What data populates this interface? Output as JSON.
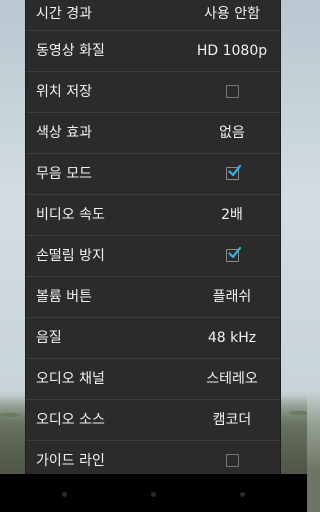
{
  "settings": [
    {
      "label": "시간 경과",
      "value": "사용 안함",
      "type": "text"
    },
    {
      "label": "동영상 화질",
      "value": "HD 1080p",
      "type": "text"
    },
    {
      "label": "위치 저장",
      "checked": false,
      "type": "checkbox"
    },
    {
      "label": "색상 효과",
      "value": "없음",
      "type": "text"
    },
    {
      "label": "무음 모드",
      "checked": true,
      "type": "checkbox"
    },
    {
      "label": "비디오 속도",
      "value": "2배",
      "type": "text"
    },
    {
      "label": "손떨림 방지",
      "checked": true,
      "type": "checkbox"
    },
    {
      "label": "볼륨 버튼",
      "value": "플래쉬",
      "type": "text"
    },
    {
      "label": "음질",
      "value": "48 kHz",
      "type": "text"
    },
    {
      "label": "오디오 채널",
      "value": "스테레오",
      "type": "text"
    },
    {
      "label": "오디오 소스",
      "value": "캠코더",
      "type": "text"
    },
    {
      "label": "가이드 라인",
      "checked": false,
      "type": "checkbox"
    }
  ],
  "colors": {
    "panel_bg": "#2b2b2b",
    "accent_check": "#33b5e5",
    "text": "#f2f2f2"
  },
  "navbar": {
    "buttons": [
      "back-icon",
      "home-icon",
      "recent-apps-icon"
    ]
  }
}
